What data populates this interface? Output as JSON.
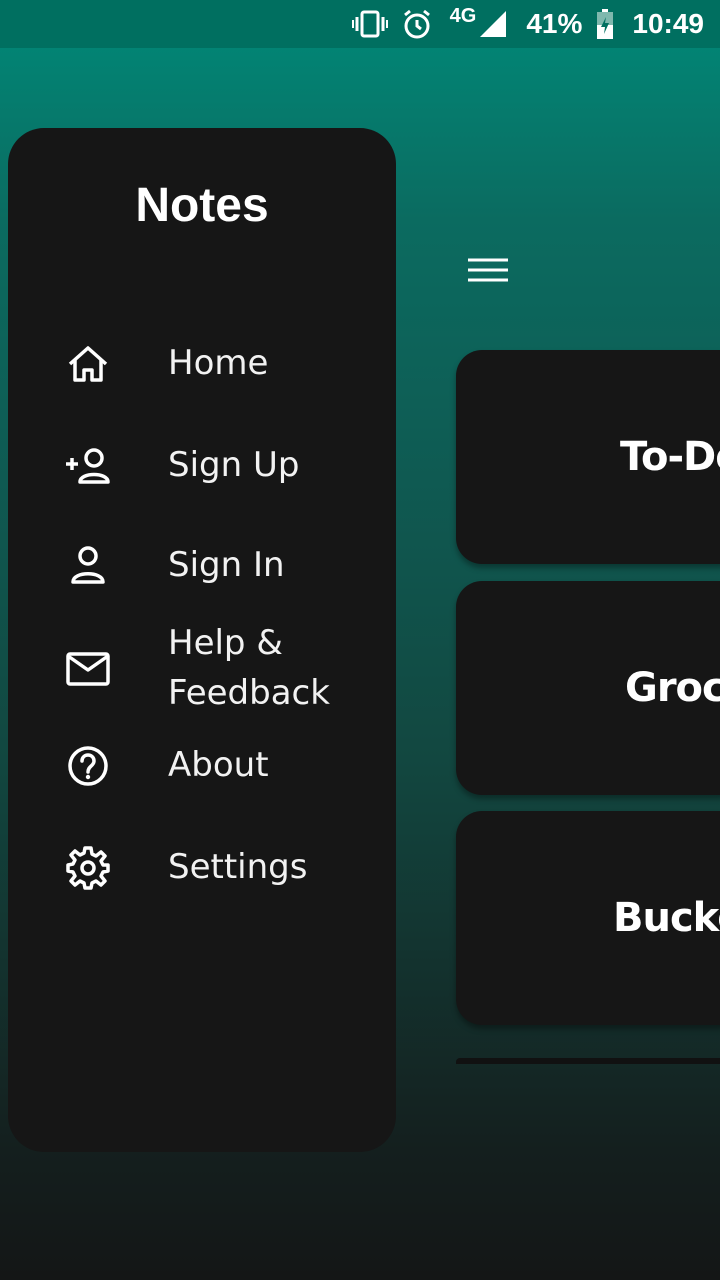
{
  "status_bar": {
    "network": "4G",
    "battery": "41%",
    "time": "10:49",
    "icons": [
      "vibrate-icon",
      "alarm-icon",
      "signal-icon",
      "battery-icon"
    ]
  },
  "drawer": {
    "title": "Notes",
    "items": [
      {
        "label": "Home",
        "icon": "home-icon"
      },
      {
        "label": "Sign Up",
        "icon": "person-add-icon"
      },
      {
        "label": "Sign In",
        "icon": "person-icon"
      },
      {
        "label": "Help &\nFeedback",
        "icon": "mail-icon"
      },
      {
        "label": "About",
        "icon": "help-circle-icon"
      },
      {
        "label": "Settings",
        "icon": "gear-icon"
      }
    ]
  },
  "main": {
    "menu_icon": "hamburger-menu-icon",
    "cards": [
      {
        "title": "To-Do"
      },
      {
        "title": "Groce"
      },
      {
        "title": "Bucke"
      }
    ]
  },
  "colors": {
    "status_bar": "#006f60",
    "gradient_top": "#008a79",
    "gradient_bottom": "#141616",
    "card_bg": "#161616",
    "drawer_bg": "#161616"
  }
}
